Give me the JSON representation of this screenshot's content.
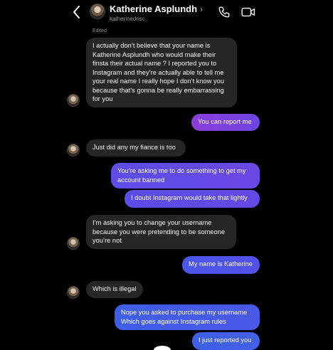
{
  "header": {
    "name": "Katherine Asplundh",
    "chevron": "›",
    "username": "katherinedrisc"
  },
  "thread": {
    "edited_label": "Edited",
    "messages": [
      {
        "from": "them",
        "lines": [
          "I actually don’t believe that your name is",
          "Katherine Asplundh who would make their",
          "finsta their actual name ? I reported you to",
          "Instagram and they’re actually able to tell me",
          "your real name I really hope I don’t know you",
          "because that’s gonna be really embarrassing",
          "for you"
        ]
      },
      {
        "from": "me",
        "lines": [
          "You can report me"
        ]
      },
      {
        "from": "them",
        "lines": [
          "Just did any my fiance is too"
        ]
      },
      {
        "from": "me",
        "lines": [
          "You’re asking me to do something to get my",
          "account banned"
        ]
      },
      {
        "from": "me",
        "lines": [
          "I doubt Instagram would take that lightly"
        ]
      },
      {
        "from": "them",
        "lines": [
          "I’m asking you to change your username",
          "because you were pretending to be someone",
          "you’re not"
        ]
      },
      {
        "from": "me",
        "lines": [
          "My name is Katherine"
        ]
      },
      {
        "from": "them",
        "lines": [
          "Which is illegal"
        ]
      },
      {
        "from": "me",
        "lines": [
          "Nope you asked to purchase my username.",
          "Which goes against Instagram rules"
        ]
      },
      {
        "from": "me",
        "lines": [
          "I just reported you"
        ]
      }
    ]
  },
  "colors": {
    "background": "#000000",
    "incoming_bubble": "#262626",
    "outgoing_gradient_purple": "#7b3fe0",
    "outgoing_gradient_blue": "#3f5de6"
  },
  "icons": [
    "back-arrow-icon",
    "phone-icon",
    "video-camera-icon"
  ]
}
